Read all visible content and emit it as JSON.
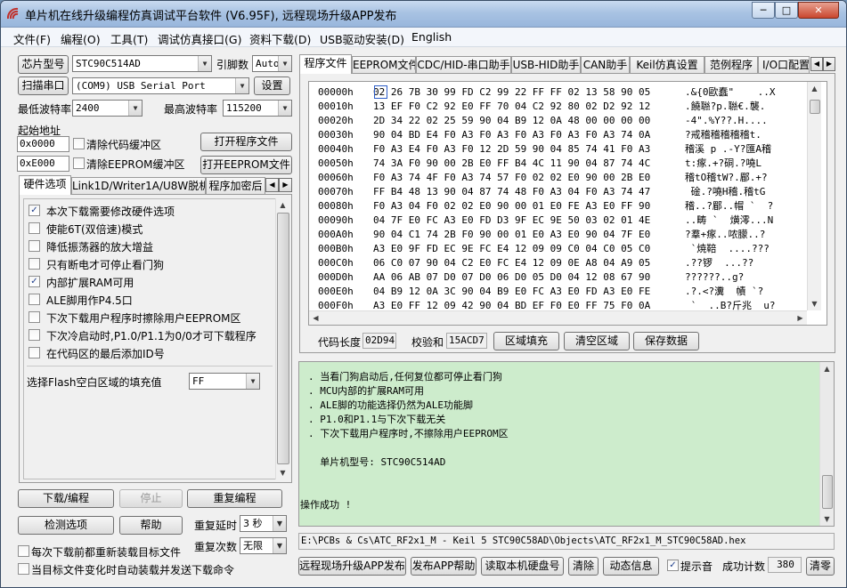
{
  "window": {
    "title": "单片机在线升级编程仿真调试平台软件 (V6.95F), 远程现场升级APP发布",
    "btn_min": "─",
    "btn_max": "□",
    "btn_close": "✕"
  },
  "menu": [
    "文件(F)",
    "编程(O)",
    "工具(T)",
    "调试仿真接口(G)",
    "资料下载(D)",
    "USB驱动安装(D)",
    "English"
  ],
  "left": {
    "chip_btn": "芯片型号",
    "chip_value": "STC90C514AD",
    "pin_label": "引脚数",
    "pin_value": "Auto",
    "scan_btn": "扫描串口",
    "port_value": "(COM9) USB Serial Port",
    "settings_btn": "设置",
    "min_baud_label": "最低波特率",
    "min_baud_value": "2400",
    "max_baud_label": "最高波特率",
    "max_baud_value": "115200",
    "start_addr_label": "起始地址",
    "addr1": "0x0000",
    "clear_code_label": "清除代码缓冲区",
    "open_prog_btn": "打开程序文件",
    "addr2": "0xE000",
    "clear_eeprom_label": "清除EEPROM缓冲区",
    "open_eeprom_btn": "打开EEPROM文件",
    "tabs": [
      "硬件选项",
      "Link1D/Writer1A/U8W脱机",
      "程序加密后"
    ],
    "options": [
      {
        "label": "本次下载需要修改硬件选项",
        "checked": true
      },
      {
        "label": "使能6T(双倍速)模式",
        "checked": false
      },
      {
        "label": "降低振荡器的放大增益",
        "checked": false
      },
      {
        "label": "只有断电才可停止看门狗",
        "checked": false
      },
      {
        "label": "内部扩展RAM可用",
        "checked": true
      },
      {
        "label": "ALE脚用作P4.5口",
        "checked": false
      },
      {
        "label": "下次下载用户程序时擦除用户EEPROM区",
        "checked": false
      },
      {
        "label": "下次冷启动时,P1.0/P1.1为0/0才可下载程序",
        "checked": false
      },
      {
        "label": "在代码区的最后添加ID号",
        "checked": false
      }
    ],
    "flash_fill_label": "选择Flash空白区域的填充值",
    "flash_fill_value": "FF",
    "download_btn": "下载/编程",
    "stop_btn": "停止",
    "reprogram_btn": "重复编程",
    "check_btn": "检测选项",
    "help_btn": "帮助",
    "repeat_delay_label": "重复延时",
    "repeat_delay_value": "3 秒",
    "repeat_count_label": "重复次数",
    "repeat_count_value": "无限",
    "reload_label": "每次下载前都重新装载目标文件",
    "auto_label": "当目标文件变化时自动装载并发送下载命令"
  },
  "right": {
    "tabs": [
      "程序文件",
      "EEPROM文件",
      "CDC/HID-串口助手",
      "USB-HID助手",
      "CAN助手",
      "Keil仿真设置",
      "范例程序",
      "I/O口配置"
    ],
    "hex": [
      {
        "addr": "00000h",
        "bytes": "02 26 7B 30 99 FD C2 99 22 FF FF 02 13 58 90 05",
        "ascii": ".&{0歐蠢\"    ..X"
      },
      {
        "addr": "00010h",
        "bytes": "13 EF F0 C2 92 E0 FF 70 04 C2 92 80 02 D2 92 12",
        "ascii": ".饒聮?p.聮€.襲."
      },
      {
        "addr": "00020h",
        "bytes": "2D 34 22 02 25 59 90 04 B9 12 0A 48 00 00 00 00",
        "ascii": "-4\".%Y??.H...."
      },
      {
        "addr": "00030h",
        "bytes": "90 04 BD E4 F0 A3 F0 A3 F0 A3 F0 A3 F0 A3 74 0A",
        "ascii": "?戒稽稽稽稽稽t."
      },
      {
        "addr": "00040h",
        "bytes": "F0 A3 E4 F0 A3 F0 12 2D 59 90 04 85 74 41 F0 A3",
        "ascii": "稽溪 p .-Y?匯A稽"
      },
      {
        "addr": "00050h",
        "bytes": "74 3A F0 90 00 2B E0 FF B4 4C 11 90 04 87 74 4C",
        "ascii": "t:瘃.+?硐.?嘵L"
      },
      {
        "addr": "00060h",
        "bytes": "F0 A3 74 4F F0 A3 74 57 F0 02 02 E0 90 00 2B E0",
        "ascii": "稽tO稽tW?.郿.+?"
      },
      {
        "addr": "00070h",
        "bytes": "FF B4 48 13 90 04 87 74 48 F0 A3 04 F0 A3 74 47",
        "ascii": " 碒.?嘵H稽.稽tG"
      },
      {
        "addr": "00080h",
        "bytes": "F0 A3 04 F0 02 02 E0 90 00 01 E0 FE A3 E0 FF 90",
        "ascii": "稽..?郿..帽 `  ?"
      },
      {
        "addr": "00090h",
        "bytes": "04 7F E0 FC A3 E0 FD D3 9F EC 9E 50 03 02 01 4E",
        "ascii": "..畴 `  熿澪...N"
      },
      {
        "addr": "000A0h",
        "bytes": "90 04 C1 74 2B F0 90 00 01 E0 A3 E0 90 04 7F E0",
        "ascii": "?羣+瘃..哝朦..?"
      },
      {
        "addr": "000B0h",
        "bytes": "A3 E0 9F FD EC 9E FC E4 12 09 09 C0 04 C0 05 C0",
        "ascii": " `焼鞛  ....???"
      },
      {
        "addr": "000C0h",
        "bytes": "06 C0 07 90 04 C2 E0 FC E4 12 09 0E A8 04 A9 05",
        "ascii": ".??锣  ...??"
      },
      {
        "addr": "000D0h",
        "bytes": "AA 06 AB 07 D0 07 D0 06 D0 05 D0 04 12 08 67 90",
        "ascii": "??????..g?"
      },
      {
        "addr": "000E0h",
        "bytes": "04 B9 12 0A 3C 90 04 B9 E0 FC A3 E0 FD A3 E0 FE",
        "ascii": ".?.<?瀵  幘 `?"
      },
      {
        "addr": "000F0h",
        "bytes": "A3 E0 FF 12 09 42 90 04 BD EF F0 E0 FF 75 F0 0A",
        "ascii": " `  ..B?斤兆  u?"
      }
    ],
    "code_len_label": "代码长度",
    "code_len_value": "02D94",
    "checksum_label": "校验和",
    "checksum_value": "15ACD7",
    "fill_btn": "区域填充",
    "clear_btn": "清空区域",
    "save_btn": "保存数据",
    "log": [
      ". 当看门狗启动后,任何复位都可停止看门狗",
      ". MCU内部的扩展RAM可用",
      ". ALE脚的功能选择仍然为ALE功能脚",
      ". P1.0和P1.1与下次下载无关",
      ". 下次下载用户程序时,不擦除用户EEPROM区",
      "",
      "  单片机型号: STC90C514AD",
      "",
      "",
      "操作成功 !"
    ],
    "path": "E:\\PCBs & Cs\\ATC_RF2x1_M - Keil 5 STC90C58AD\\Objects\\ATC_RF2x1_M_STC90C58AD.hex",
    "remote_btn": "远程现场升级APP发布",
    "publish_help_btn": "发布APP帮助",
    "read_disk_btn": "读取本机硬盘号",
    "clear_log_btn": "清除",
    "anim_btn": "动态信息",
    "beep_label": "提示音",
    "success_label": "成功计数",
    "success_value": "380",
    "reset_btn": "清零"
  }
}
